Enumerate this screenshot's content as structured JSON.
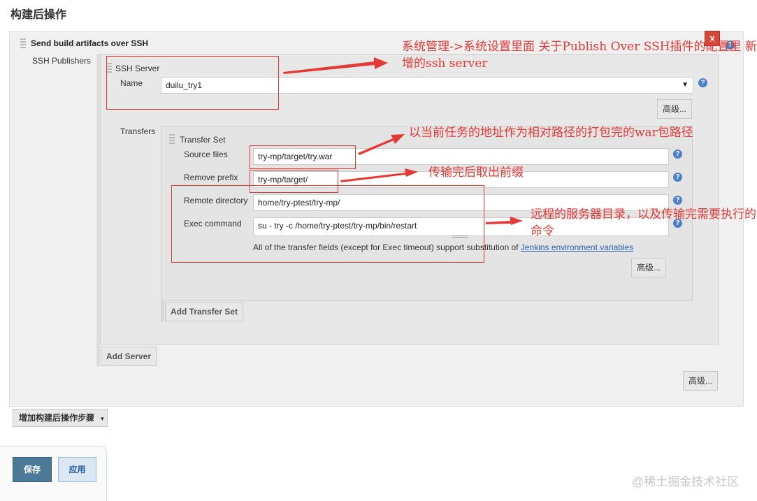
{
  "section_title": "构建后操作",
  "plugin": {
    "title": "Send build artifacts over SSH",
    "close_label": "X",
    "publishers_label": "SSH Publishers",
    "advanced_label": "高级..."
  },
  "ssh_server": {
    "header": "SSH Server",
    "name_label": "Name",
    "name_value": "duilu_try1",
    "advanced_label": "高级...",
    "transfers_label": "Transfers",
    "add_server_label": "Add Server"
  },
  "transfer_set": {
    "header": "Transfer Set",
    "source_files_label": "Source files",
    "source_files_value": "try-mp/target/try.war",
    "remove_prefix_label": "Remove prefix",
    "remove_prefix_value": "try-mp/target/",
    "remote_directory_label": "Remote directory",
    "remote_directory_value": "home/try-ptest/try-mp/",
    "exec_command_label": "Exec command",
    "exec_command_value": "su - try -c /home/try-ptest/try-mp/bin/restart",
    "note_text": "All of the transfer fields (except for Exec timeout) support substitution of ",
    "note_link": "Jenkins environment variables",
    "advanced_label": "高级...",
    "add_transfer_label": "Add Transfer Set"
  },
  "add_post_build_step_label": "增加构建后操作步骤",
  "save_label": "保存",
  "apply_label": "应用",
  "annotations": {
    "ssh_server_note": "系统管理->系统设置里面 关于Publish Over SSH插件的配置里 新增的ssh server",
    "source_files_note": "以当前任务的地址作为相对路径的打包完的war包路径",
    "remove_prefix_note": "传输完后取出前缀",
    "remote_note": "远程的服务器目录，以及传输完需要执行的命令"
  },
  "help_icon_glyph": "?",
  "watermark": "@稀土掘金技术社区",
  "colors": {
    "annotation_red": "#e53935",
    "save_button": "#4a7a95",
    "link_blue": "#2a5db0",
    "help_blue": "#4c7fc9"
  }
}
